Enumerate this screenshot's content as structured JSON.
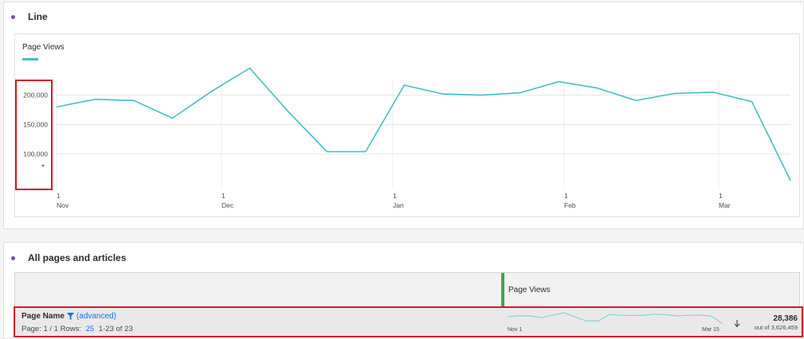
{
  "panel1": {
    "title": "Line"
  },
  "chart_data": {
    "type": "line",
    "series": [
      {
        "name": "Page Views",
        "values": [
          180000,
          193000,
          191000,
          161000,
          206000,
          246000,
          172000,
          104000,
          104000,
          217000,
          202000,
          200000,
          204000,
          223000,
          212000,
          191000,
          203000,
          205000,
          189000,
          55000
        ]
      }
    ],
    "ylim": [
      40000,
      250000
    ],
    "yticks": [
      100000,
      150000,
      200000
    ],
    "ytick_labels": [
      "100,000",
      "150,000",
      "200,000"
    ],
    "xtick_labels": [
      {
        "day": "1",
        "month": "Nov"
      },
      {
        "day": "1",
        "month": "Dec"
      },
      {
        "day": "1",
        "month": "Jan"
      },
      {
        "day": "1",
        "month": "Feb"
      },
      {
        "day": "1",
        "month": "Mar"
      }
    ],
    "grid": true,
    "line_color": "#40c0c6"
  },
  "panel2": {
    "title": "All pages and articles",
    "column_header": "Page Views",
    "dimension_label": "Page Name",
    "advanced_label": "(advanced)",
    "page_info": "Page: 1 / 1  Rows:",
    "rows_per_page": "25",
    "row_range": "1-23 of 23",
    "spark_start": "Nov 1",
    "spark_end": "Mar 15",
    "total": "28,386",
    "total_of": "out of 3,626,459"
  },
  "colors": {
    "accent_line": "#40c0c6",
    "bullet": "#7a4c9c",
    "highlight": "#d7181e",
    "link": "#1473e6",
    "column_marker": "#3da74e"
  }
}
